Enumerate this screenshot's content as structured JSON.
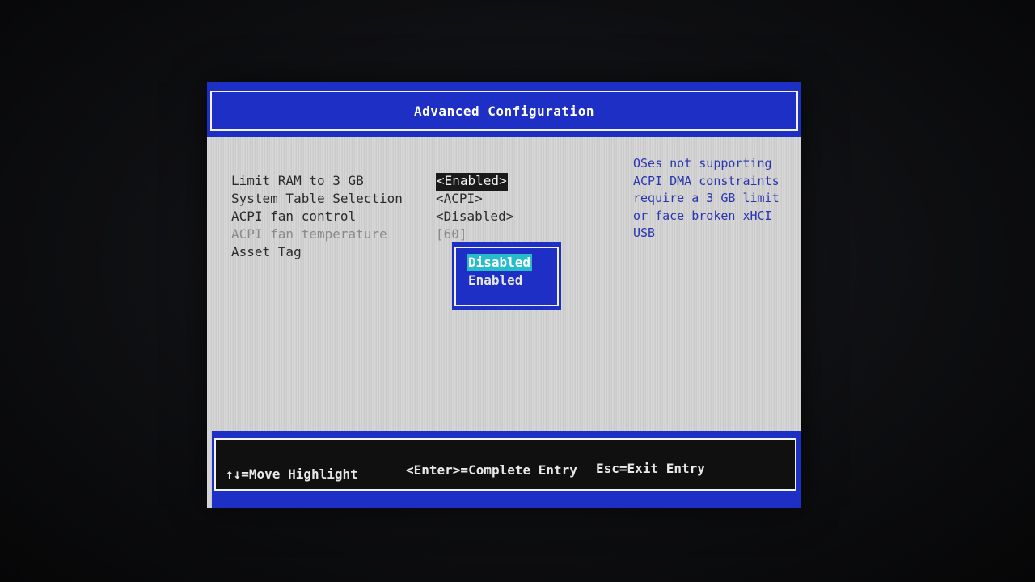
{
  "window": {
    "title": "Advanced Configuration"
  },
  "settings": [
    {
      "label": "Limit RAM to 3 GB",
      "value": "<Enabled>",
      "state": "selected"
    },
    {
      "label": "System Table Selection",
      "value": "<ACPI>",
      "state": "normal"
    },
    {
      "label": "ACPI fan control",
      "value": "<Disabled>",
      "state": "normal"
    },
    {
      "label": "ACPI fan temperature",
      "value": "[60]",
      "state": "disabled"
    },
    {
      "label": "Asset Tag",
      "value": "_",
      "state": "normal"
    }
  ],
  "help": {
    "lines": [
      "OSes not supporting",
      "ACPI DMA constraints",
      "require a 3 GB limit",
      "or face broken xHCI",
      "USB"
    ]
  },
  "popup": {
    "options": [
      "Disabled",
      "Enabled"
    ],
    "highlighted": "Disabled"
  },
  "footer": {
    "move": "↑↓=Move Highlight",
    "enter": "<Enter>=Complete Entry",
    "esc": "Esc=Exit Entry"
  },
  "colors": {
    "bios_blue": "#1d2fc4",
    "panel_gray": "#d3d3d3",
    "help_text_blue": "#2a36b0",
    "popup_highlight_cyan": "#27bcc9"
  }
}
